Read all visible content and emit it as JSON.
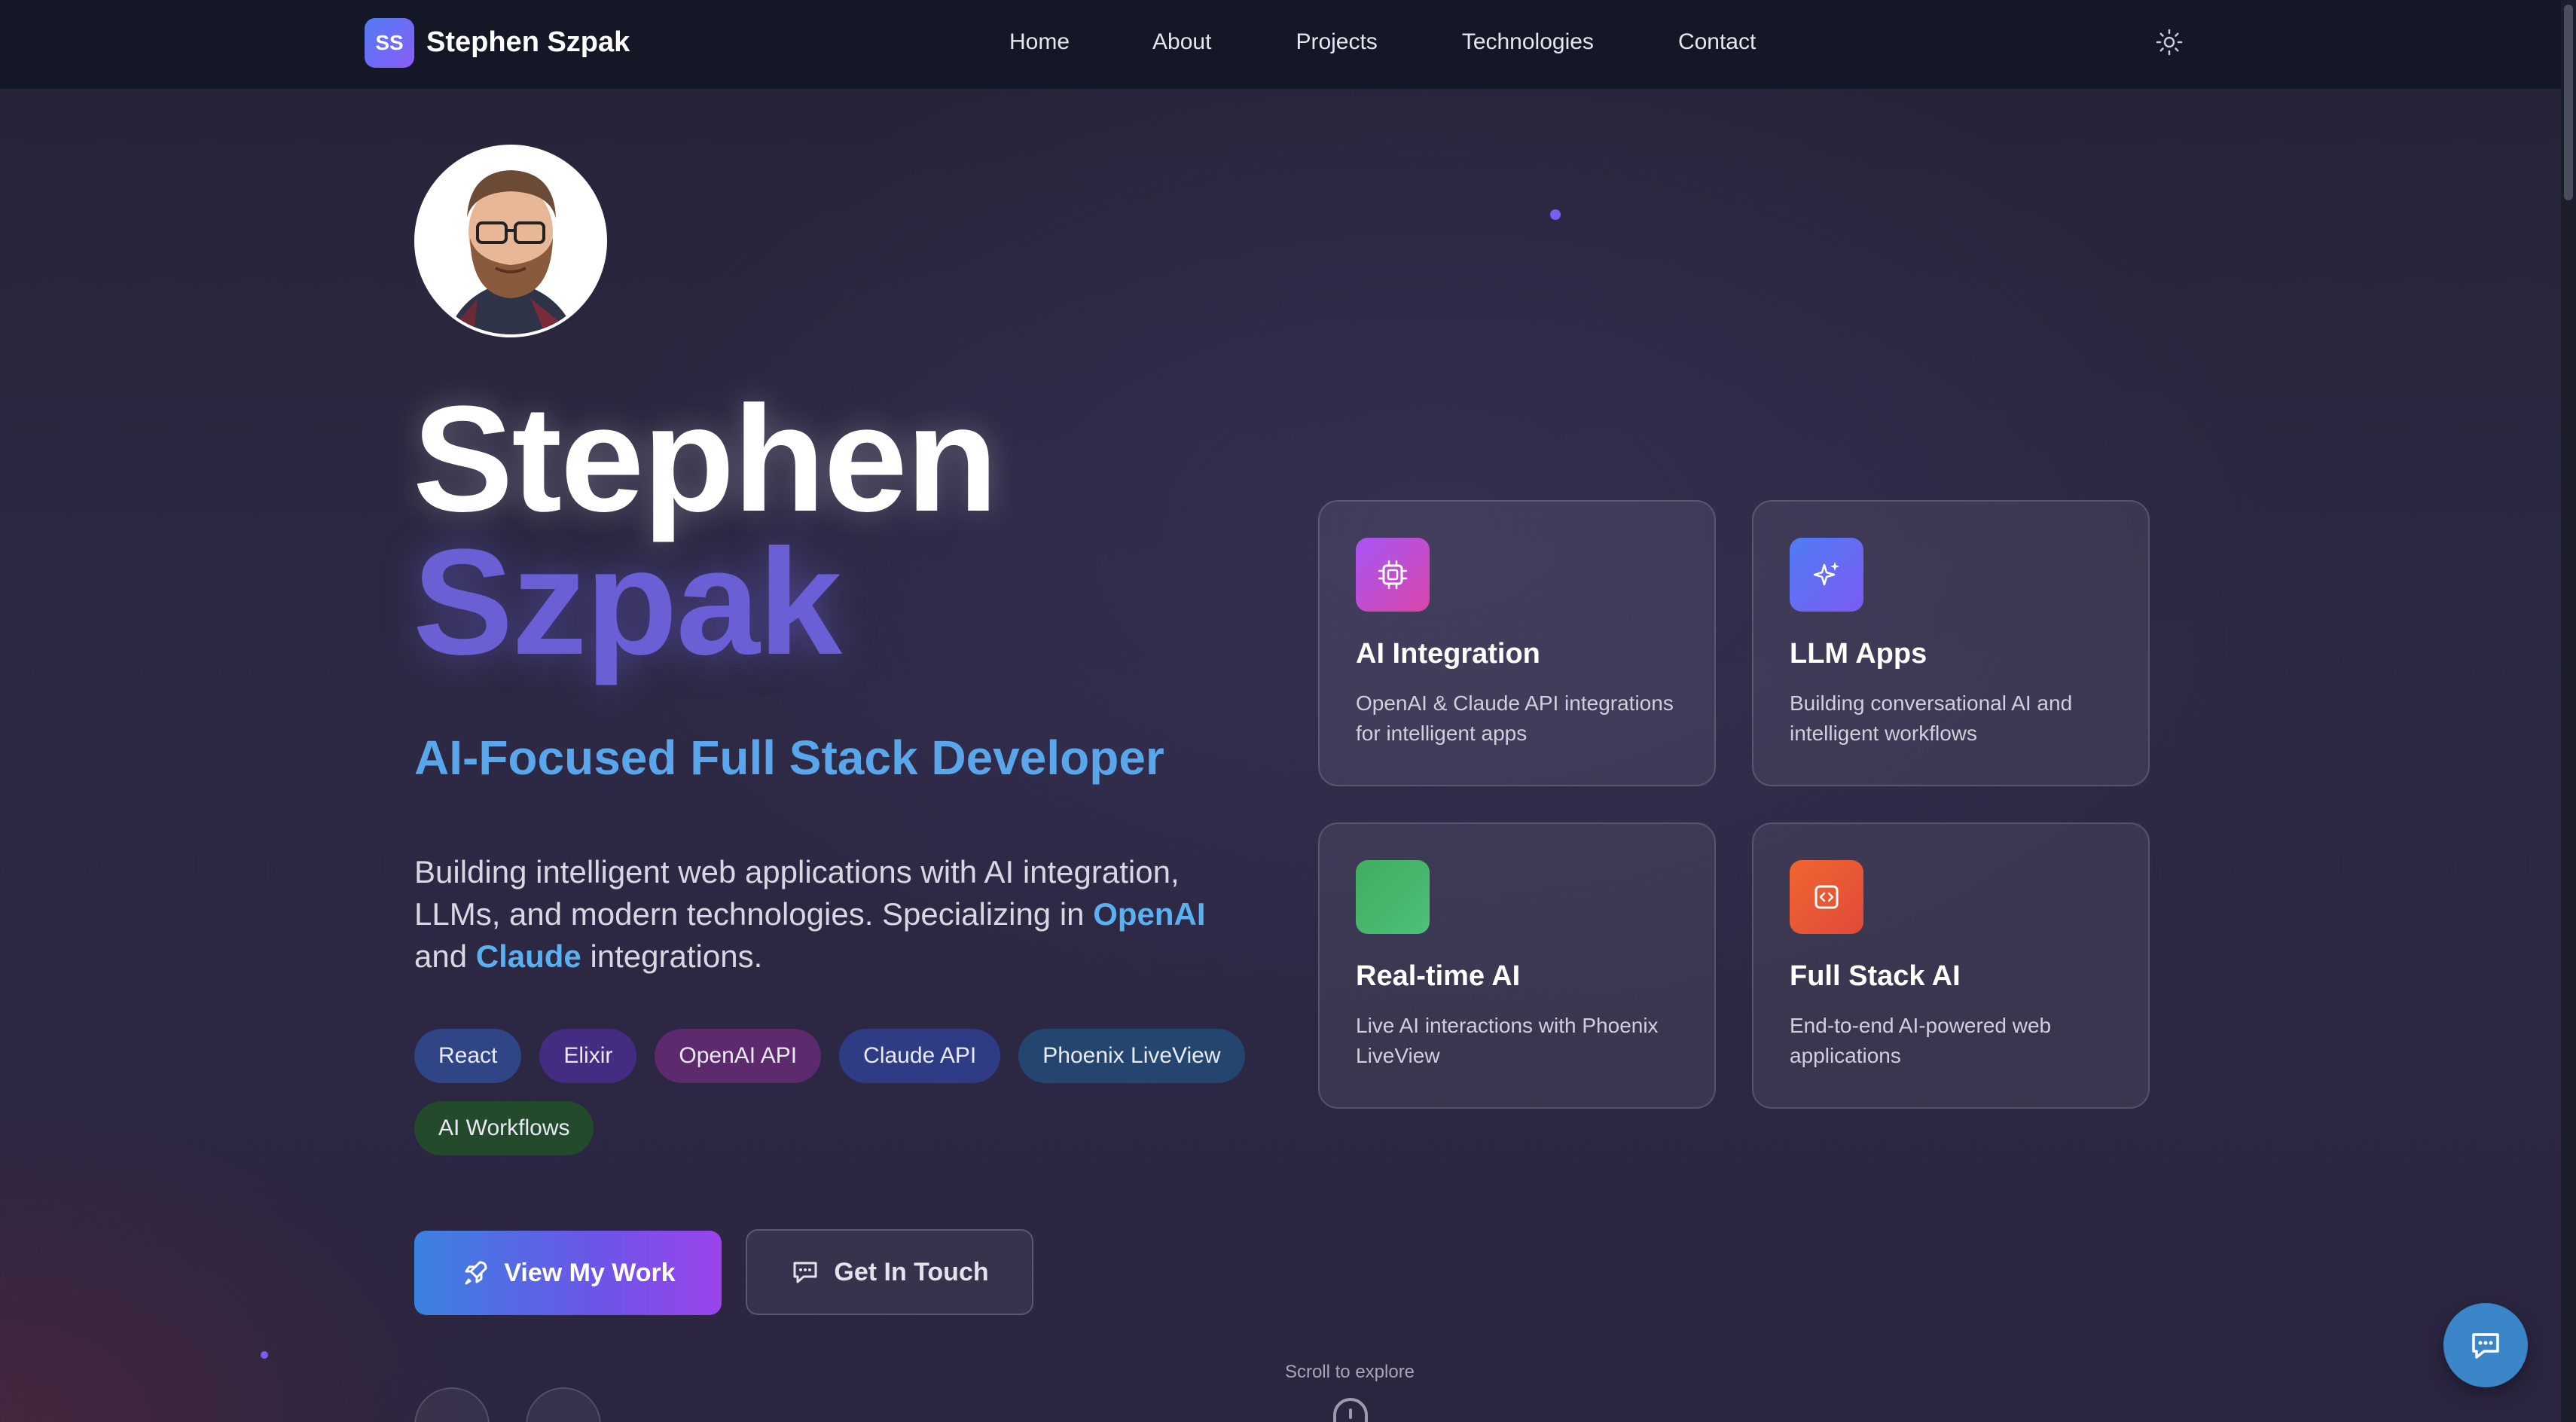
{
  "nav": {
    "logo_initials": "SS",
    "logo_name": "Stephen Szpak",
    "links": [
      "Home",
      "About",
      "Projects",
      "Technologies",
      "Contact"
    ],
    "theme_icon": "sun-icon"
  },
  "hero": {
    "first_name": "Stephen",
    "last_name": "Szpak",
    "role": "AI-Focused Full Stack Developer",
    "desc_part1": "Building intelligent web applications with AI integration, LLMs, and modern technologies. Specializing in ",
    "desc_hl1": "OpenAI",
    "desc_part2": " and ",
    "desc_hl2": "Claude",
    "desc_part3": " integrations.",
    "tags": [
      {
        "label": "React",
        "color": "#2f4585"
      },
      {
        "label": "Elixir",
        "color": "#432c82"
      },
      {
        "label": "OpenAI API",
        "color": "#5d2a6e"
      },
      {
        "label": "Claude API",
        "color": "#2e3c86"
      },
      {
        "label": "Phoenix LiveView",
        "color": "#24466e"
      },
      {
        "label": "AI Workflows",
        "color": "#244a2c"
      }
    ],
    "primary_button": "View My Work",
    "secondary_button": "Get In Touch"
  },
  "cards": [
    {
      "title": "AI Integration",
      "desc": "OpenAI & Claude API integrations for intelligent apps",
      "icon": "chip-icon",
      "gradient": [
        "#a855f7",
        "#d946a8"
      ]
    },
    {
      "title": "LLM Apps",
      "desc": "Building conversational AI and intelligent workflows",
      "icon": "sparkles-icon",
      "gradient": [
        "#4f7cf5",
        "#7c5cf3"
      ]
    },
    {
      "title": "Real-time AI",
      "desc": "Live AI interactions with Phoenix LiveView",
      "icon": "bolt-icon",
      "gradient": [
        "#3fae5e",
        "#4fbf7a"
      ]
    },
    {
      "title": "Full Stack AI",
      "desc": "End-to-end AI-powered web applications",
      "icon": "code-icon",
      "gradient": [
        "#f0652f",
        "#e04a3a"
      ]
    }
  ],
  "scroll_hint": "Scroll to explore",
  "colors": {
    "accent": "#6b5fd6",
    "highlight": "#5ab0f0",
    "nav_bg": "#141826",
    "chat": "#3a86c8"
  }
}
